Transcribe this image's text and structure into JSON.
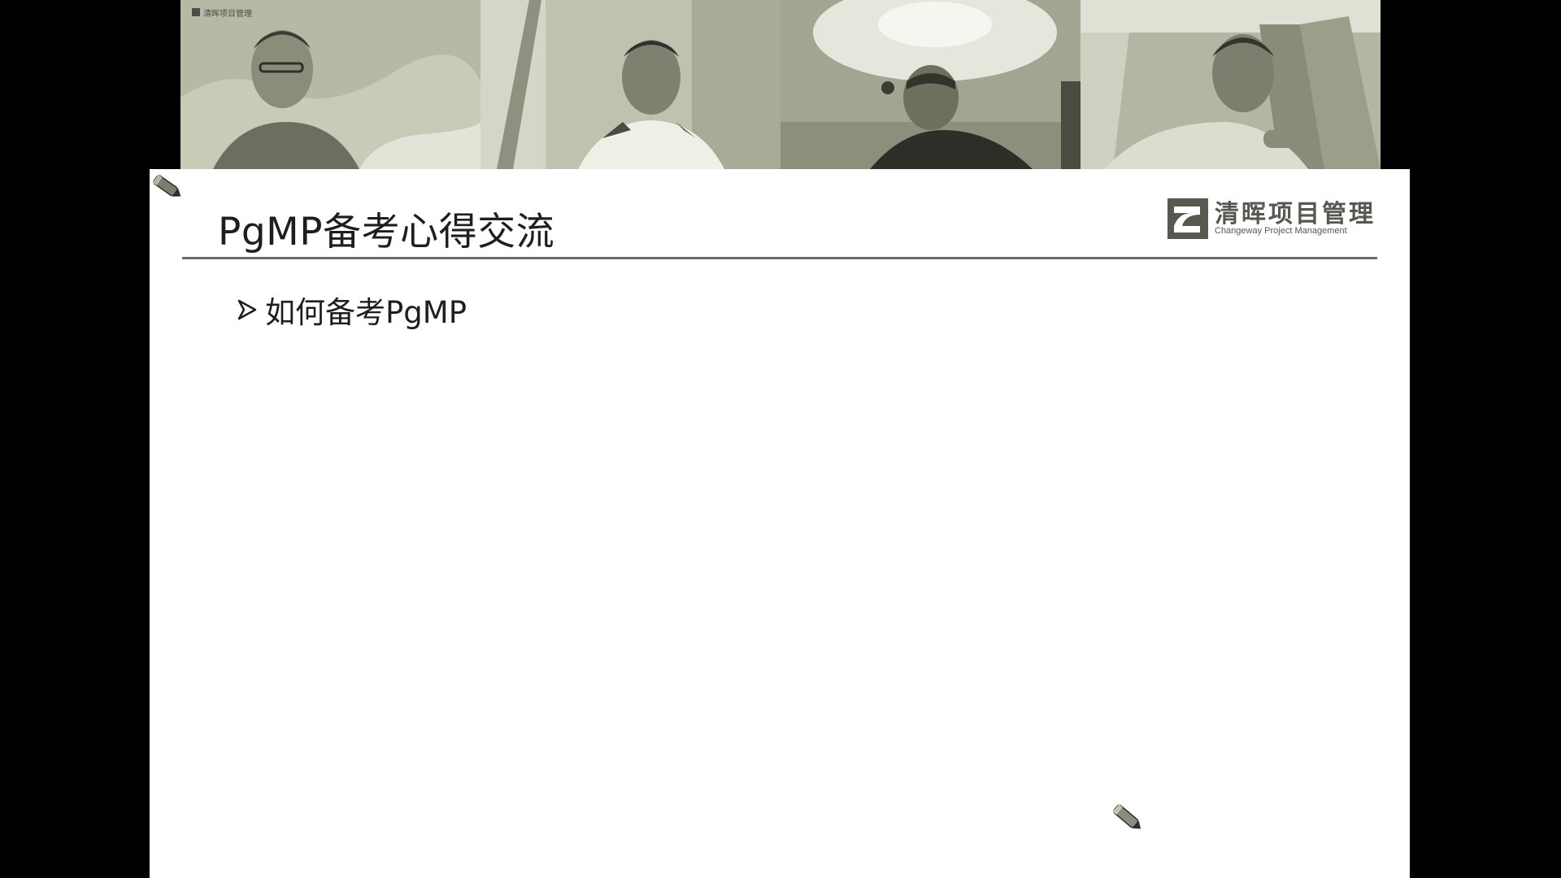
{
  "slide": {
    "title": "PgMP备考心得交流",
    "bullets": [
      {
        "text": "如何备考PgMP"
      }
    ],
    "brand": {
      "name_cn": "清晖项目管理",
      "name_en": "Changeway Project Management"
    }
  },
  "participants": [
    {
      "tile_logo_cn": "清晖项目管理"
    },
    {},
    {},
    {}
  ],
  "colors": {
    "video_tint": "#b9bcaa",
    "slide_background": "#ffffff",
    "title_rule": "#6a6e66",
    "brand": "#55594f"
  },
  "icons": [
    "pen-cursor-icon",
    "bullet-arrow-icon",
    "brand-logo-icon"
  ]
}
